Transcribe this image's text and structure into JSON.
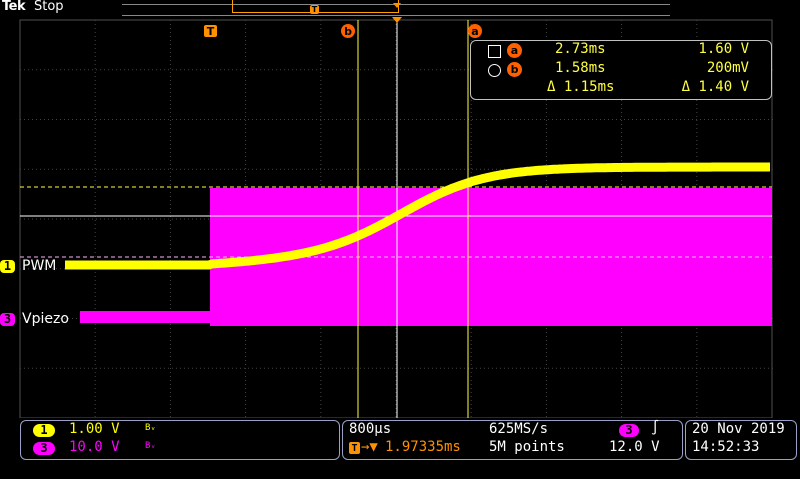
{
  "header": {
    "brand": "Tek",
    "state": "Stop"
  },
  "markers": {
    "trigger": "T",
    "cursor_a": "a",
    "cursor_b": "b"
  },
  "cursor_readout": {
    "a": {
      "time": "2.73ms",
      "value": "1.60 V"
    },
    "b": {
      "time": "1.58ms",
      "value": "200mV"
    },
    "delta": {
      "time": "Δ 1.15ms",
      "value": "Δ 1.40 V"
    }
  },
  "channels": [
    {
      "num": "1",
      "label": "PWM",
      "scale": "1.00 V",
      "bw": "Bᵥ",
      "color": "#ffff00"
    },
    {
      "num": "3",
      "label": "Vpiezo",
      "scale": "10.0 V",
      "bw": "Bᵥ",
      "color": "#ff00ff"
    }
  ],
  "timebase": {
    "scale": "800µs",
    "position": "1.97335ms",
    "sample_rate": "625MS/s",
    "record": "5M points"
  },
  "trigger": {
    "source": "3",
    "slope_icon": "rising-edge-icon",
    "level": "12.0 V"
  },
  "datetime": {
    "date": "20 Nov 2019",
    "time": "14:52:33"
  },
  "colors": {
    "ch1": "#ffff00",
    "ch3": "#ff00ff",
    "cursor": "#ffff40",
    "accent": "#ff8000"
  }
}
